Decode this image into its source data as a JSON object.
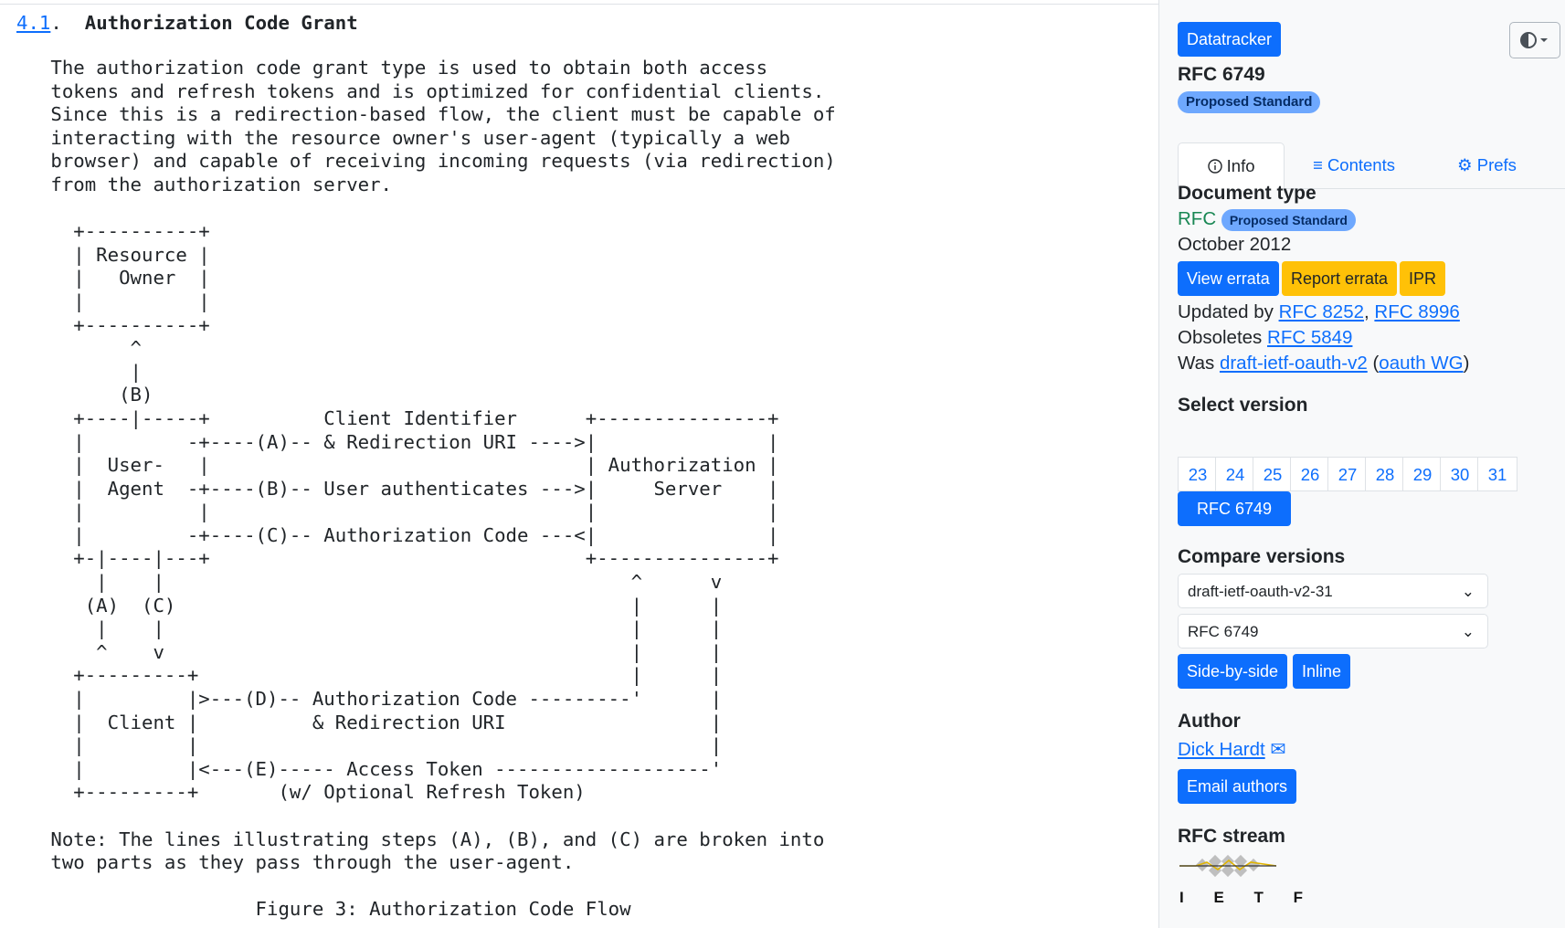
{
  "document": {
    "section_number": "4.1",
    "section_title": "Authorization Code Grant",
    "body_lines": [
      "   The authorization code grant type is used to obtain both access",
      "   tokens and refresh tokens and is optimized for confidential clients.",
      "   Since this is a redirection-based flow, the client must be capable of",
      "   interacting with the resource owner's user-agent (typically a web",
      "   browser) and capable of receiving incoming requests (via redirection)",
      "   from the authorization server.",
      "",
      "     +----------+",
      "     | Resource |",
      "     |   Owner  |",
      "     |          |",
      "     +----------+",
      "          ^",
      "          |",
      "         (B)",
      "     +----|-----+          Client Identifier      +---------------+",
      "     |         -+----(A)-- & Redirection URI ---->|               |",
      "     |  User-   |                                 | Authorization |",
      "     |  Agent  -+----(B)-- User authenticates --->|     Server    |",
      "     |          |                                 |               |",
      "     |         -+----(C)-- Authorization Code ---<|               |",
      "     +-|----|---+                                 +---------------+",
      "       |    |                                         ^      v",
      "      (A)  (C)                                        |      |",
      "       |    |                                         |      |",
      "       ^    v                                         |      |",
      "     +---------+                                      |      |",
      "     |         |>---(D)-- Authorization Code ---------'      |",
      "     |  Client |          & Redirection URI                  |",
      "     |         |                                             |",
      "     |         |<---(E)----- Access Token -------------------'",
      "     +---------+       (w/ Optional Refresh Token)",
      "",
      "   Note: The lines illustrating steps (A), (B), and (C) are broken into",
      "   two parts as they pass through the user-agent.",
      "",
      "                     Figure 3: Authorization Code Flow"
    ]
  },
  "sidebar": {
    "datatracker_label": "Datatracker",
    "rfc_title": "RFC 6749",
    "status_badge": "Proposed Standard",
    "theme_icon": "half-circle-theme-icon",
    "tabs": [
      {
        "label": "Info",
        "icon": "info-circle-icon",
        "active": true
      },
      {
        "label": "Contents",
        "icon": "list-icon",
        "active": false
      },
      {
        "label": "Prefs",
        "icon": "gear-icon",
        "active": false
      }
    ],
    "doc_type_heading": "Document type",
    "doc_type": "RFC",
    "doc_type_badge": "Proposed Standard",
    "date": "October 2012",
    "view_errata": "View errata",
    "report_errata": "Report errata",
    "ipr": "IPR",
    "updated_by_label": "Updated by",
    "updated_by": [
      "RFC 8252",
      "RFC 8996"
    ],
    "obsoletes_label": "Obsoletes",
    "obsoletes": "RFC 5849",
    "was_label": "Was",
    "was_draft": "draft-ietf-oauth-v2",
    "was_wg": "oauth WG",
    "select_version_heading": "Select version",
    "versions": [
      "23",
      "24",
      "25",
      "26",
      "27",
      "28",
      "29",
      "30",
      "31"
    ],
    "current_version": "RFC 6749",
    "compare_heading": "Compare versions",
    "compare_from": "draft-ietf-oauth-v2-31",
    "compare_to": "RFC 6749",
    "side_by_side": "Side-by-side",
    "inline": "Inline",
    "author_heading": "Author",
    "author": "Dick Hardt",
    "email_authors": "Email authors",
    "stream_heading": "RFC stream",
    "stream_logo_text": "I E T F"
  },
  "colors": {
    "accent": "#0d6efd",
    "warning": "#ffc107",
    "badge": "#6ea8fe",
    "rfc_green": "#198754"
  }
}
